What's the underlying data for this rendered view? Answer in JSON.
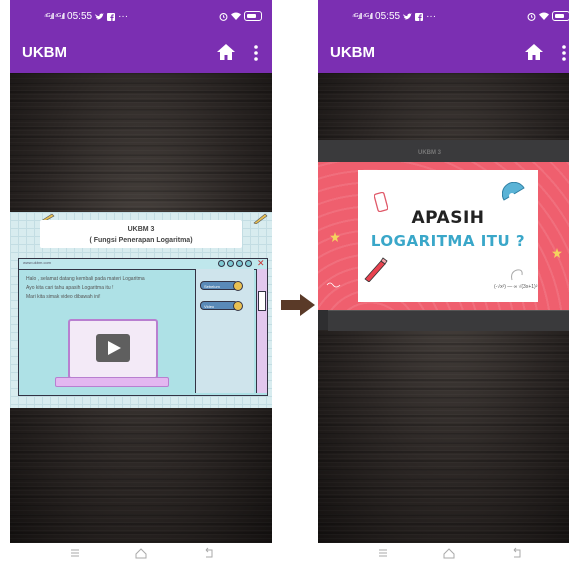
{
  "status_bar": {
    "time": "05:55",
    "signal": "⁴ᴳ.ıll ⁴ᴳ.ıll",
    "notification_dots": "···"
  },
  "app_bar": {
    "title": "UKBM"
  },
  "left_slide": {
    "title_line1": "UKBM 3",
    "title_line2": "( Fungsi Penerapan Logaritma)",
    "window_title": "www.ukbm.com",
    "text_line1": "Halo , selamat datang kembali pada materi Logaritma",
    "text_line2": "Ayo kita cari tahu apasih Logaritma itu !",
    "text_line3": "Mari kita simak video dibawah ini!",
    "side_button1": "Sebelum",
    "side_button2": "Video"
  },
  "right_slide": {
    "dim_title": "UKBM 3",
    "heading_line1": "APASIH",
    "heading_line2": "LOGARITMA ITU ?",
    "formula": "(-√x²) — ∞ √(3x+1)²"
  },
  "colors": {
    "app_purple": "#7b2fb2",
    "slide_red": "#ef5f6e",
    "accent_blue": "#3aa7c9"
  }
}
